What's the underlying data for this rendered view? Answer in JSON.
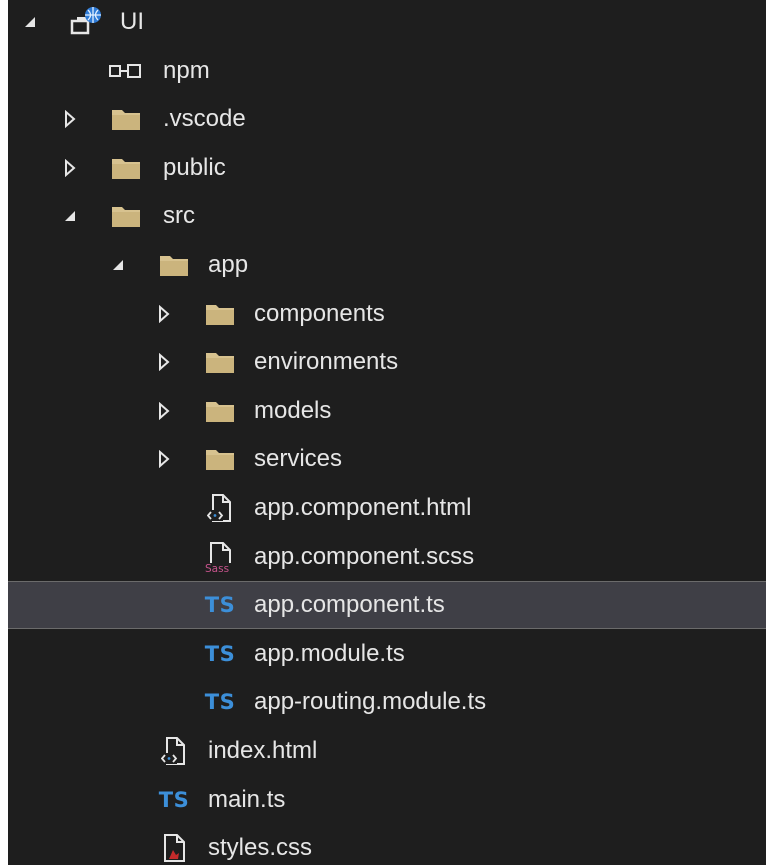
{
  "colors": {
    "background": "#1e1e1e",
    "selection": "#3f3f46",
    "text": "#e6e6e6",
    "folder": "#d7c28f",
    "ts": "#3c8fd9",
    "sass": "#c6538c"
  },
  "tree": [
    {
      "label": "UI",
      "arrow": "expanded",
      "icon": "project-globe-icon",
      "depth": 0
    },
    {
      "label": "npm",
      "arrow": "none",
      "icon": "npm-package-icon",
      "depth": 1
    },
    {
      "label": ".vscode",
      "arrow": "collapsed",
      "icon": "folder-icon",
      "depth": 1
    },
    {
      "label": "public",
      "arrow": "collapsed",
      "icon": "folder-icon",
      "depth": 1
    },
    {
      "label": "src",
      "arrow": "expanded",
      "icon": "folder-icon",
      "depth": 1
    },
    {
      "label": "app",
      "arrow": "expanded",
      "icon": "folder-icon",
      "depth": 2
    },
    {
      "label": "components",
      "arrow": "collapsed",
      "icon": "folder-icon",
      "depth": 3
    },
    {
      "label": "environments",
      "arrow": "collapsed",
      "icon": "folder-icon",
      "depth": 3
    },
    {
      "label": "models",
      "arrow": "collapsed",
      "icon": "folder-icon",
      "depth": 3
    },
    {
      "label": "services",
      "arrow": "collapsed",
      "icon": "folder-icon",
      "depth": 3
    },
    {
      "label": "app.component.html",
      "arrow": "none",
      "icon": "html-file-icon",
      "depth": 3
    },
    {
      "label": "app.component.scss",
      "arrow": "none",
      "icon": "sass-file-icon",
      "icon_text": "Sass",
      "depth": 3
    },
    {
      "label": "app.component.ts",
      "arrow": "none",
      "icon": "typescript-file-icon",
      "icon_text": "TS",
      "depth": 3,
      "selected": true
    },
    {
      "label": "app.module.ts",
      "arrow": "none",
      "icon": "typescript-file-icon",
      "icon_text": "TS",
      "depth": 3
    },
    {
      "label": "app-routing.module.ts",
      "arrow": "none",
      "icon": "typescript-file-icon",
      "icon_text": "TS",
      "depth": 3
    },
    {
      "label": "index.html",
      "arrow": "none",
      "icon": "html-file-icon",
      "depth": 2
    },
    {
      "label": "main.ts",
      "arrow": "none",
      "icon": "typescript-file-icon",
      "icon_text": "TS",
      "depth": 2
    },
    {
      "label": "styles.css",
      "arrow": "none",
      "icon": "css-file-icon",
      "depth": 2
    }
  ]
}
